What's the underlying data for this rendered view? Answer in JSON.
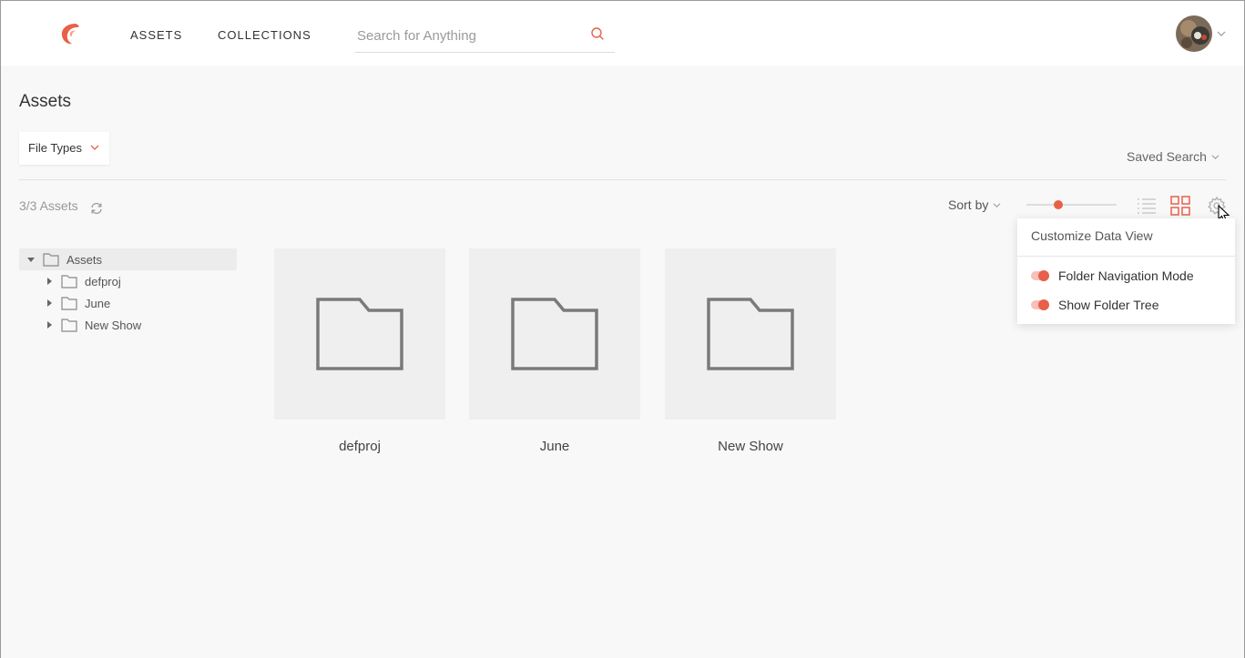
{
  "header": {
    "nav": [
      {
        "label": "ASSETS"
      },
      {
        "label": "COLLECTIONS"
      }
    ],
    "search": {
      "placeholder": "Search for Anything",
      "value": ""
    }
  },
  "page": {
    "title": "Assets",
    "file_types_label": "File Types",
    "saved_search_label": "Saved Search",
    "asset_count": "3/3 Assets",
    "sort_by_label": "Sort by",
    "thumbnail_size_fraction": 0.35
  },
  "tree": {
    "root": {
      "label": "Assets",
      "expanded": true
    },
    "children": [
      {
        "label": "defproj"
      },
      {
        "label": "June"
      },
      {
        "label": "New Show"
      }
    ]
  },
  "grid": {
    "items": [
      {
        "label": "defproj"
      },
      {
        "label": "June"
      },
      {
        "label": "New Show"
      }
    ]
  },
  "customize_panel": {
    "title": "Customize Data View",
    "options": [
      {
        "label": "Folder Navigation Mode",
        "enabled": true
      },
      {
        "label": "Show Folder Tree",
        "enabled": true
      }
    ]
  },
  "colors": {
    "accent": "#e8604a",
    "accent_light": "#f6c1b8",
    "folder_icon": "#7a7a7a",
    "background": "#f8f8f8"
  },
  "icons": {
    "logo": "brand-logo",
    "search": "search-icon",
    "refresh": "refresh-icon",
    "list_view": "list-view-icon",
    "grid_view": "grid-view-icon",
    "settings": "gear-icon",
    "folder": "folder-icon"
  }
}
